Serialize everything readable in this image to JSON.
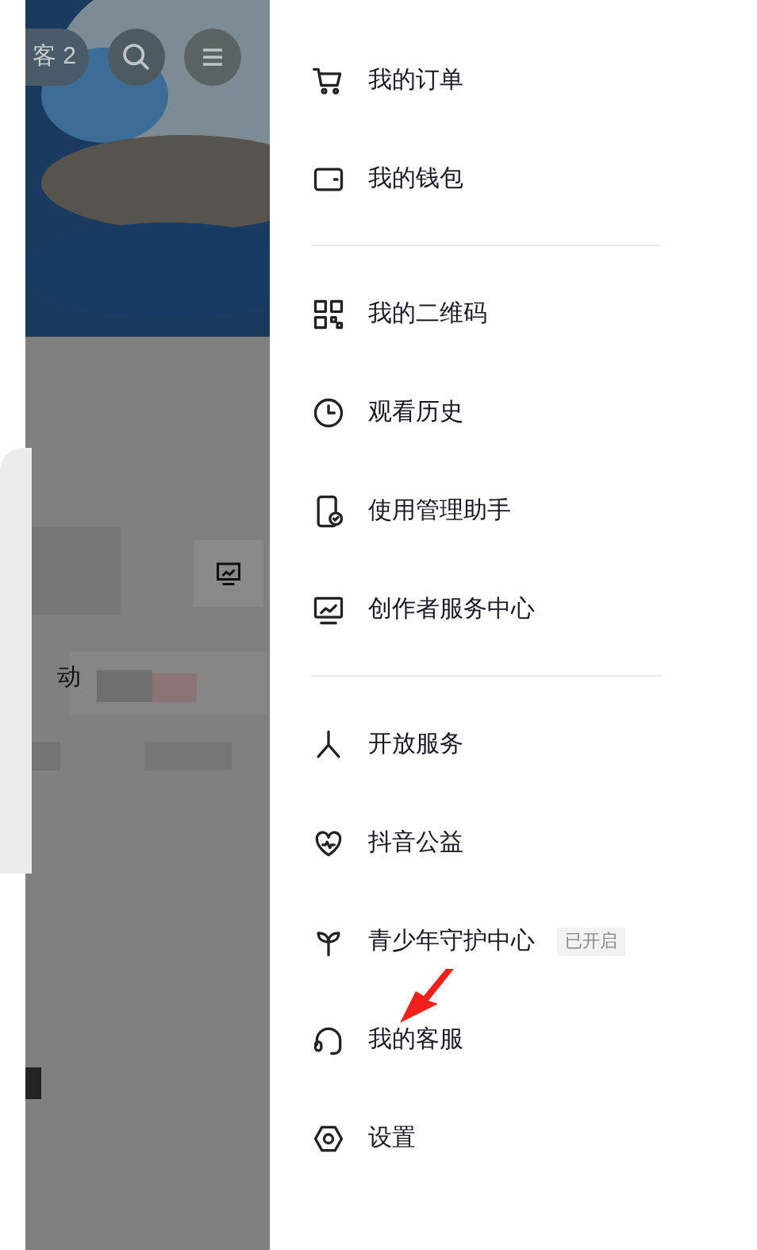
{
  "background": {
    "guest_pill": "客 2",
    "card_text": "动"
  },
  "drawer": {
    "groups": [
      {
        "items": [
          {
            "kind": "cart",
            "label": "我的订单"
          },
          {
            "kind": "wallet",
            "label": "我的钱包"
          }
        ]
      },
      {
        "items": [
          {
            "kind": "qr",
            "label": "我的二维码"
          },
          {
            "kind": "clock",
            "label": "观看历史"
          },
          {
            "kind": "phone",
            "label": "使用管理助手"
          },
          {
            "kind": "monitor",
            "label": "创作者服务中心"
          }
        ]
      },
      {
        "items": [
          {
            "kind": "asterisk",
            "label": "开放服务"
          },
          {
            "kind": "heart",
            "label": "抖音公益"
          },
          {
            "kind": "sprout",
            "label": "青少年守护中心",
            "badge": "已开启"
          },
          {
            "kind": "headset",
            "label": "我的客服"
          },
          {
            "kind": "hexagon",
            "label": "设置"
          }
        ]
      }
    ]
  }
}
